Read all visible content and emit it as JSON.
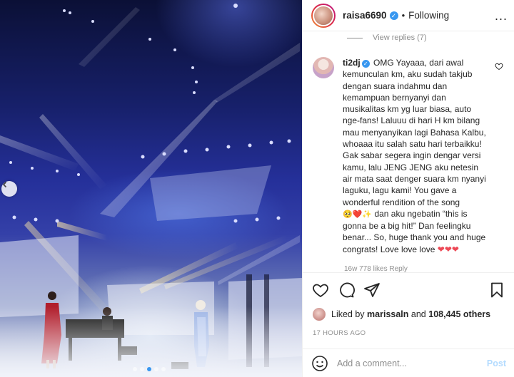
{
  "post": {
    "username": "raisa6690",
    "separator": "•",
    "follow_status": "Following",
    "more": "..."
  },
  "comments": {
    "view_replies": "View replies (7)",
    "featured": {
      "username": "ti2dj",
      "text": "OMG Yayaaa, dari awal kemunculan km, aku sudah takjub dengan suara indahmu dan kemampuan bernyanyi dan musikalitas km yg luar biasa, auto nge-fans! Laluuu di hari H km bilang mau menyanyikan lagi Bahasa Kalbu, whoaaa itu salah satu hari terbaikku! Gak sabar segera ingin dengar versi kamu, lalu JENG JENG aku netesin air mata saat denger suara km nyanyi laguku, lagu kami! You gave a wonderful rendition of the song",
      "emojis_1": "🥺❤️✨",
      "text_2": "dan aku ngebatin “this is gonna be a big hit!” Dan feelingku benar... So, huge thank you and huge congrats! Love love love",
      "emojis_2": "❤❤❤",
      "meta": "16w   778 likes   Reply"
    }
  },
  "likes": {
    "prefix": "Liked by",
    "user": "marissaln",
    "connector": "and",
    "others": "108,445 others"
  },
  "timestamp": "17 HOURS AGO",
  "add_comment": {
    "placeholder": "Add a comment...",
    "post_label": "Post"
  },
  "carousel": {
    "slides": 5,
    "active_index": 2
  },
  "colors": {
    "accent": "#3897f0",
    "heart": "#ed4956",
    "muted": "#8e8e8e"
  }
}
